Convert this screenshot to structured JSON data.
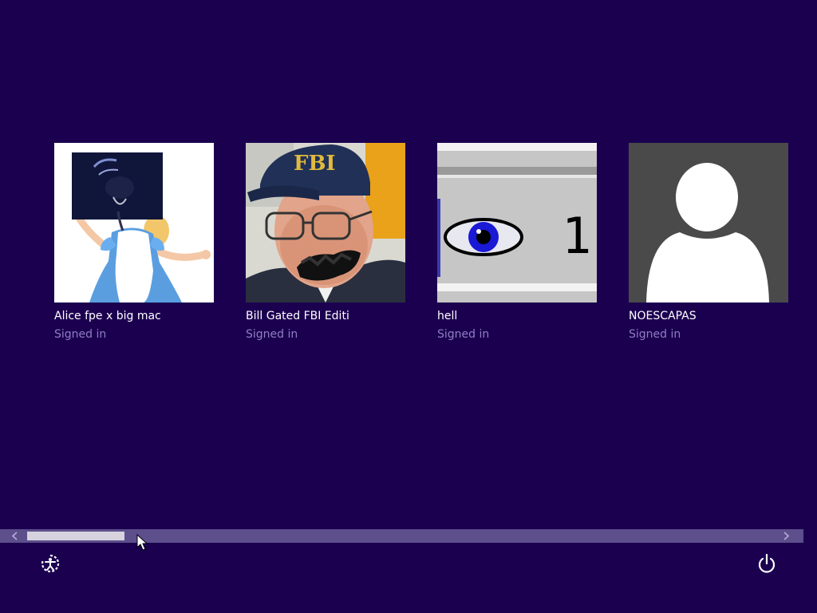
{
  "accounts": [
    {
      "name": "Alice fpe x big mac",
      "status": "Signed in",
      "avatar_icon": "alice-avatar-image"
    },
    {
      "name": "Bill Gated FBI Editi",
      "status": "Signed in",
      "avatar_icon": "fbi-cap-portrait-image"
    },
    {
      "name": "hell",
      "status": "Signed in",
      "avatar_icon": "eye-counter-image",
      "avatar_text": "1"
    },
    {
      "name": "NOESCAPAS",
      "status": "Signed in",
      "avatar_icon": "default-user-icon"
    }
  ],
  "scrollbar": {
    "left_arrow_icon": "chevron-left-icon",
    "right_arrow_icon": "chevron-right-icon",
    "position_fraction": 0.0
  },
  "bottom_bar": {
    "ease_of_access_icon": "ease-of-access-icon",
    "power_icon": "power-icon"
  },
  "colors": {
    "background": "#1b0050",
    "status_text": "#8f7fc2",
    "scrollbar": "#5d4e8c",
    "default_avatar_bg": "#4a4a4a"
  }
}
